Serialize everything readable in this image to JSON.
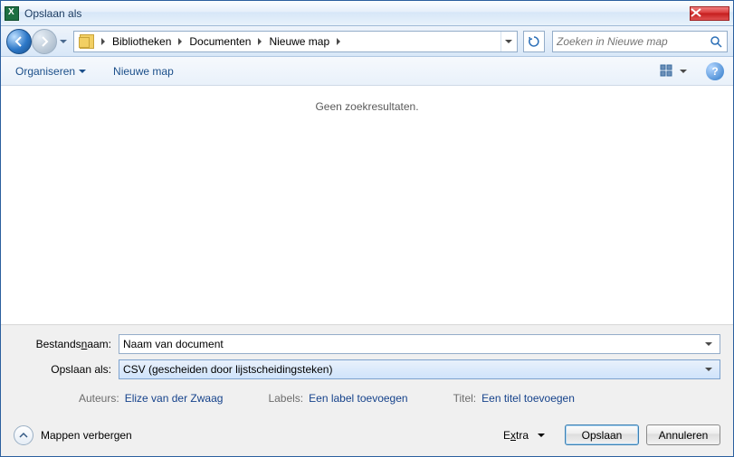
{
  "titlebar": {
    "title": "Opslaan als"
  },
  "nav": {
    "breadcrumbs": [
      "Bibliotheken",
      "Documenten",
      "Nieuwe map"
    ],
    "search_placeholder": "Zoeken in Nieuwe map"
  },
  "toolbar": {
    "organize": "Organiseren",
    "new_folder": "Nieuwe map"
  },
  "filearea": {
    "empty_text": "Geen zoekresultaten."
  },
  "fields": {
    "filename_label_pre": "Bestands",
    "filename_label_ul": "n",
    "filename_label_post": "aam:",
    "filename_value": "Naam van document",
    "saveas_label": "Opslaan als:",
    "saveas_value": "CSV (gescheiden door lijstscheidingsteken)"
  },
  "meta": {
    "authors_label": "Auteurs:",
    "authors_value": "Elize van der Zwaag",
    "labels_label": "Labels:",
    "labels_value": "Een label toevoegen",
    "title_label": "Titel:",
    "title_value": "Een titel toevoegen"
  },
  "footer": {
    "hide_folders": "Mappen verbergen",
    "extra_pre": "E",
    "extra_ul": "x",
    "extra_post": "tra",
    "save": "Opslaan",
    "cancel": "Annuleren"
  }
}
